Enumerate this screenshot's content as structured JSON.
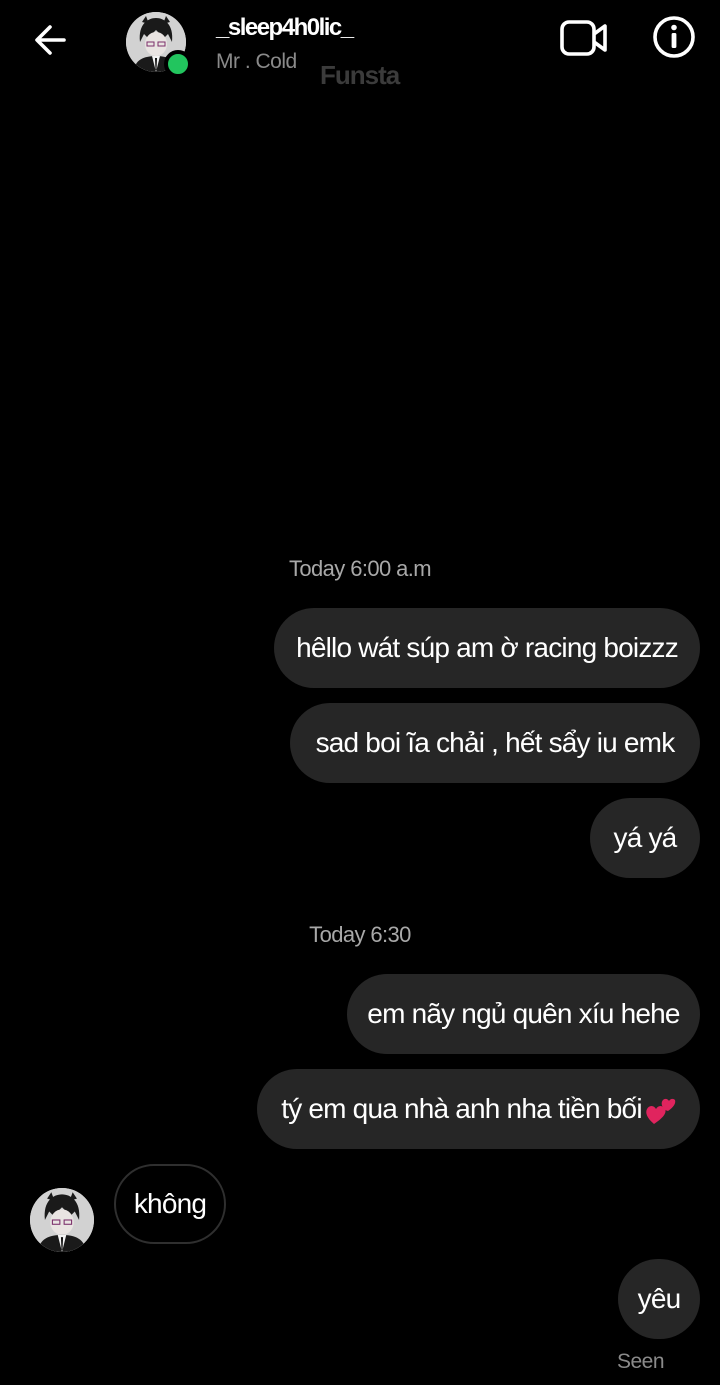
{
  "header": {
    "username": "_sleep4h0lic_",
    "subname": "Mr . Cold",
    "watermark": "Funsta",
    "online_color": "#22c55e",
    "icons": {
      "back": "arrow-left-icon",
      "video": "video-camera-icon",
      "info": "info-icon"
    }
  },
  "timestamps": {
    "first": "Today 6:00 a.m",
    "second": "Today 6:30"
  },
  "messages": [
    {
      "from": "me",
      "text": "hêllo wát súp am ờ racing boizzz"
    },
    {
      "from": "me",
      "text": "sad boi ĩa chải , hết sẩy iu emk"
    },
    {
      "from": "me",
      "text": "yá yá"
    },
    {
      "from": "me",
      "text": "em nãy ngủ quên xíu hehe"
    },
    {
      "from": "me",
      "text": "tý em qua nhà anh nha tiền bối",
      "emoji": "two-hearts-icon"
    },
    {
      "from": "them",
      "text": "không"
    },
    {
      "from": "me",
      "text": "yêu"
    }
  ],
  "status": {
    "seen": "Seen"
  },
  "colors": {
    "background": "#000000",
    "bubble_sent": "#262626",
    "bubble_received_border": "#2f2f2f",
    "muted_text": "#a8a8a8",
    "heart": "#e0245e"
  }
}
